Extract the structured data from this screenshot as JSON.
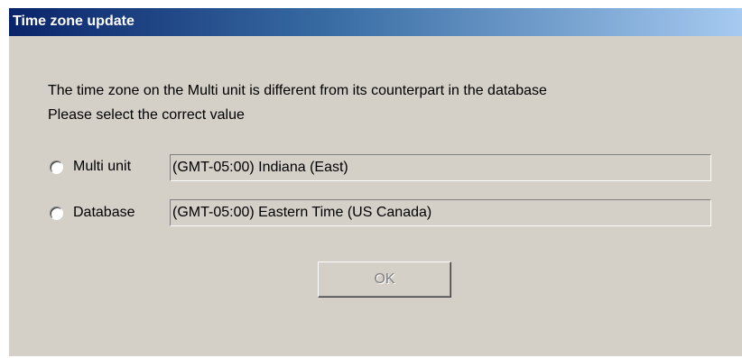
{
  "window": {
    "title": "Time zone update"
  },
  "message": {
    "line1": "The time zone on the Multi unit is different from its counterpart in the database",
    "line2": "Please select the correct value"
  },
  "options": [
    {
      "label": "Multi unit",
      "value": "(GMT-05:00) Indiana (East)",
      "selected": false
    },
    {
      "label": "Database",
      "value": "(GMT-05:00) Eastern Time (US  Canada)",
      "selected": false
    }
  ],
  "buttons": {
    "ok_label": "OK",
    "ok_enabled": false
  },
  "colors": {
    "dialog_background": "#d4d0c8",
    "titlebar_start": "#0a246a",
    "titlebar_end": "#a6caf0",
    "disabled_text": "#808080"
  }
}
